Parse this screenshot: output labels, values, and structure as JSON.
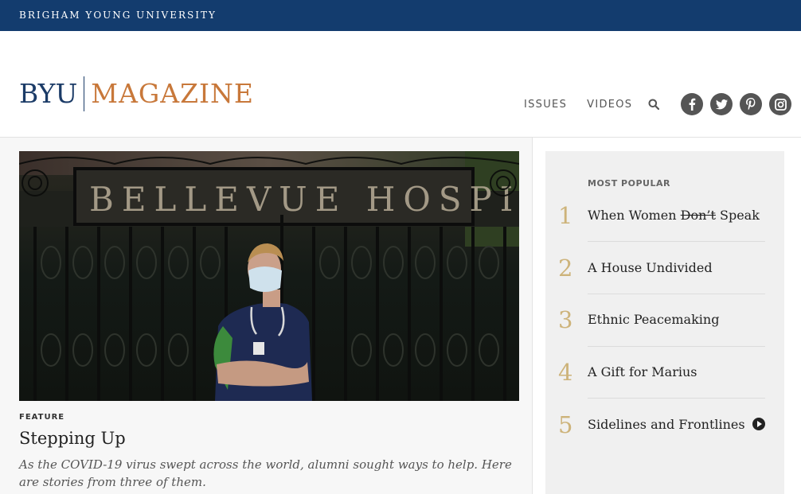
{
  "topbar": {
    "university": "BRIGHAM YOUNG UNIVERSITY"
  },
  "logo": {
    "byu": "BYU",
    "magazine": "MAGAZINE"
  },
  "nav": {
    "issues": "ISSUES",
    "videos": "VIDEOS"
  },
  "social": [
    "facebook-icon",
    "twitter-icon",
    "pinterest-icon",
    "instagram-icon"
  ],
  "feature": {
    "kicker": "FEATURE",
    "title": "Stepping Up",
    "dek": "As the COVID-19 virus swept across the world, alumni sought ways to help. Here are stories from three of them.",
    "image_caption_text": "BELLEVUE HOSPITAL"
  },
  "popular": {
    "heading": "MOST POPULAR",
    "items": [
      {
        "num": "1",
        "before": "When Women ",
        "struck": "Don’t",
        "after": " Speak"
      },
      {
        "num": "2",
        "label": "A House Undivided"
      },
      {
        "num": "3",
        "label": "Ethnic Peacemaking"
      },
      {
        "num": "4",
        "label": "A Gift for Marius"
      },
      {
        "num": "5",
        "label": "Sidelines and Frontlines"
      }
    ]
  },
  "colors": {
    "topbar": "#133c6e",
    "byu_blue": "#1b3b67",
    "magazine_orange": "#c8783a",
    "number_gold": "#cdb37a"
  }
}
